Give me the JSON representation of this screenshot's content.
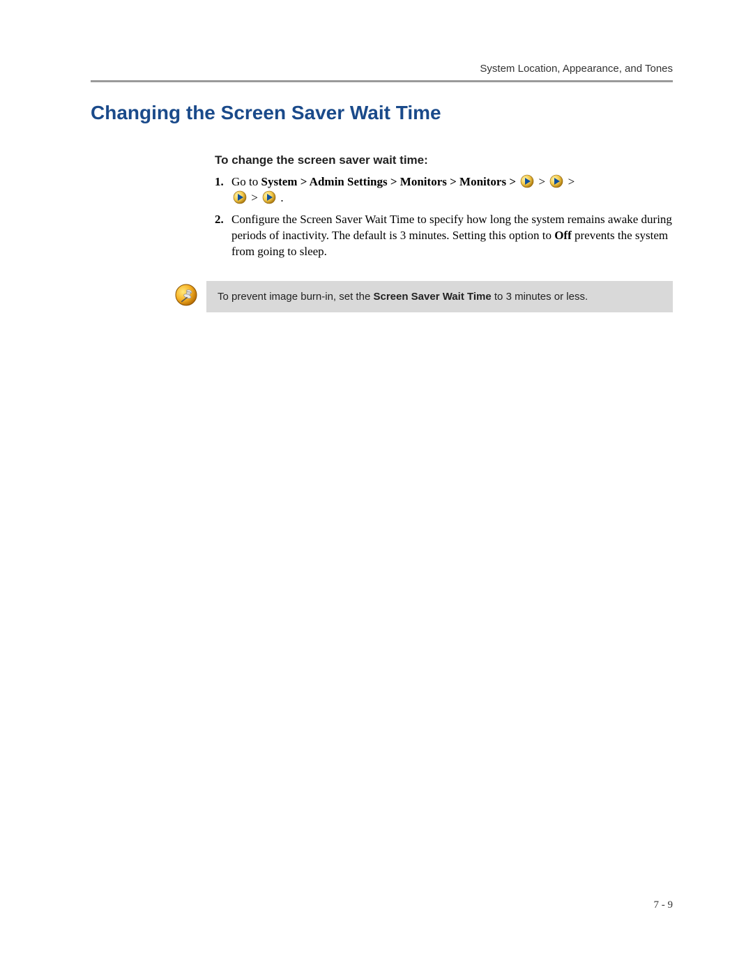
{
  "header": {
    "chapter_label": "System Location, Appearance, and Tones"
  },
  "title": "Changing the Screen Saver Wait Time",
  "subheading": "To change the screen saver wait time:",
  "steps": [
    {
      "num": "1.",
      "pre": "Go to ",
      "path": "System > Admin Settings > Monitors > Monitors > ",
      "sep": " > ",
      "end": " ."
    },
    {
      "num": "2.",
      "text_a": "Configure the Screen Saver Wait Time to specify how long the system remains awake during periods of inactivity. The default is 3 minutes. Setting this option to ",
      "off": "Off",
      "text_b": " prevents the system from going to sleep."
    }
  ],
  "note": {
    "pre": "To prevent image burn-in, set the ",
    "bold": "Screen Saver Wait Time",
    "post": " to 3 minutes or less."
  },
  "footer": {
    "page": "7 - 9"
  },
  "arrow_count": 4
}
